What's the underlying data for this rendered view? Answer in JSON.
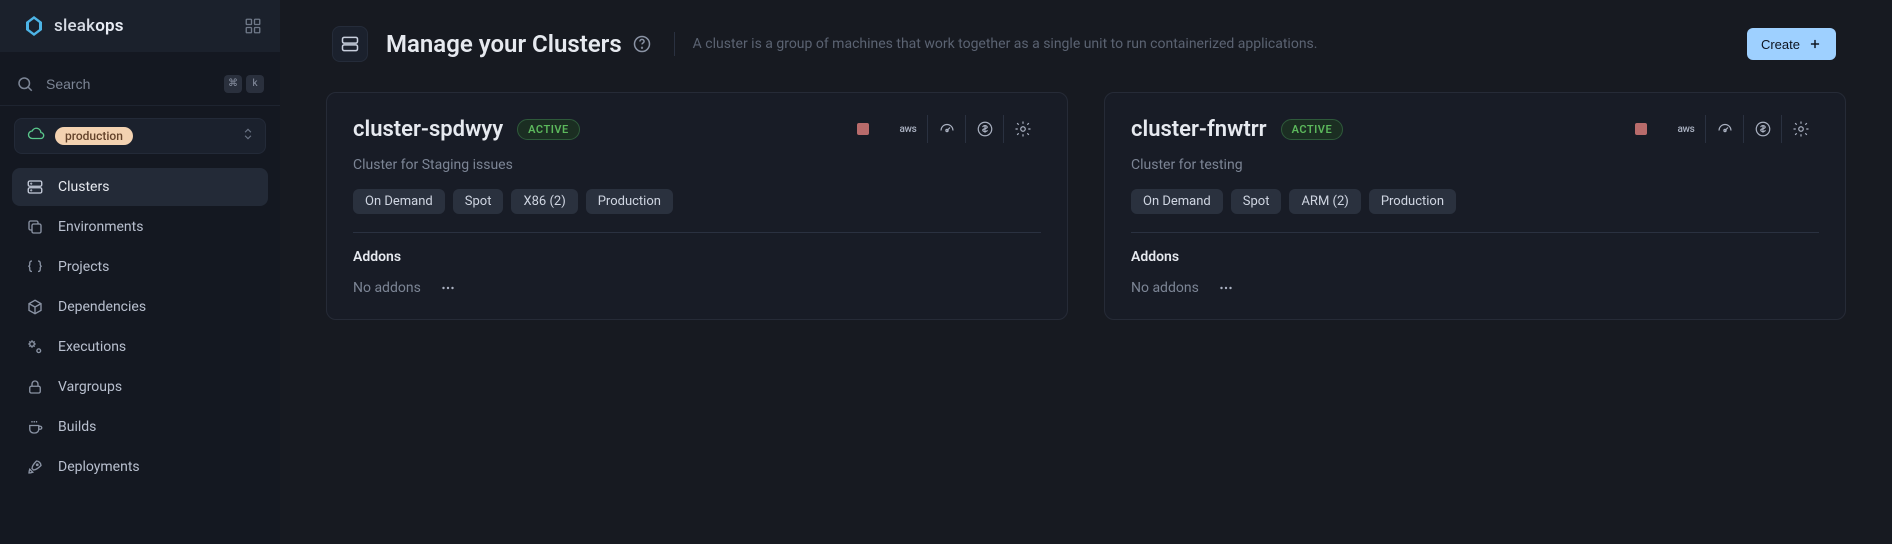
{
  "logo": {
    "brand": "sleak",
    "brand_suffix": "ops"
  },
  "search": {
    "placeholder": "Search",
    "kbd1": "⌘",
    "kbd2": "k"
  },
  "env_selector": {
    "label": "production"
  },
  "sidebar": {
    "items": [
      {
        "label": "Clusters",
        "icon": "server"
      },
      {
        "label": "Environments",
        "icon": "copy"
      },
      {
        "label": "Projects",
        "icon": "braces"
      },
      {
        "label": "Dependencies",
        "icon": "cube"
      },
      {
        "label": "Executions",
        "icon": "gears"
      },
      {
        "label": "Vargroups",
        "icon": "lock"
      },
      {
        "label": "Builds",
        "icon": "coffee"
      },
      {
        "label": "Deployments",
        "icon": "rocket"
      }
    ]
  },
  "header": {
    "title": "Manage your Clusters",
    "desc": "A cluster is a group of machines that work together as a single unit to run containerized applications.",
    "create_label": "Create"
  },
  "clusters": [
    {
      "name": "cluster-spdwyy",
      "status": "ACTIVE",
      "description": "Cluster for Staging issues",
      "tags": [
        "On Demand",
        "Spot",
        "X86 (2)",
        "Production"
      ],
      "addons_title": "Addons",
      "no_addons": "No addons",
      "provider": "aws"
    },
    {
      "name": "cluster-fnwtrr",
      "status": "ACTIVE",
      "description": "Cluster for testing",
      "tags": [
        "On Demand",
        "Spot",
        "ARM (2)",
        "Production"
      ],
      "addons_title": "Addons",
      "no_addons": "No addons",
      "provider": "aws"
    }
  ]
}
